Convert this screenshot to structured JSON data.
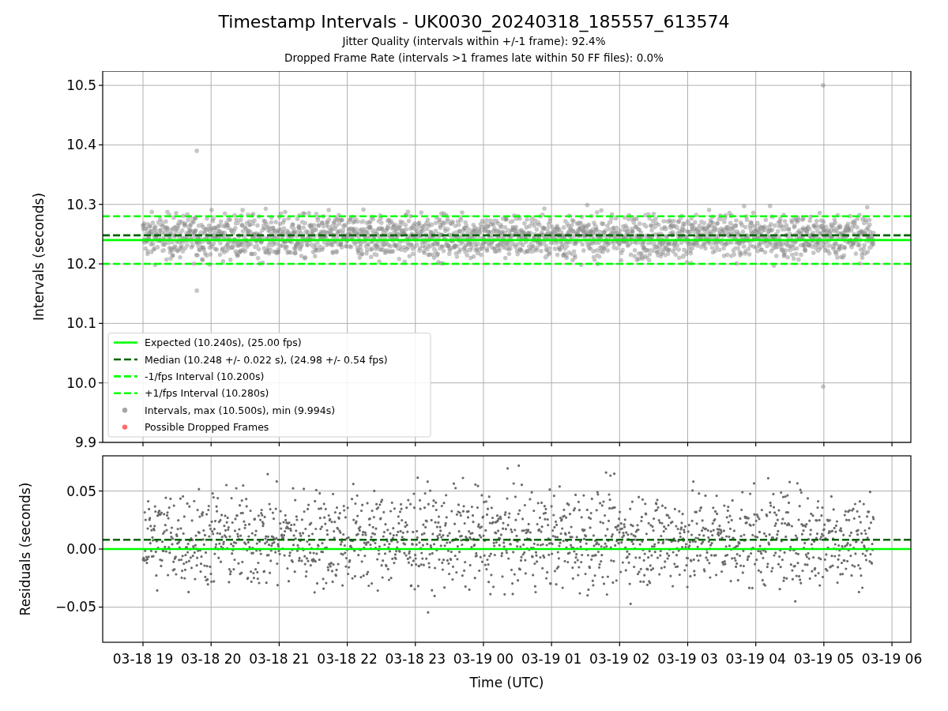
{
  "figure": {
    "title": "Timestamp Intervals - UK0030_20240318_185557_613574",
    "subtitles": [
      "Jitter Quality (intervals within +/-1 frame): 92.4%",
      "Dropped Frame Rate (intervals >1 frames late within 50 FF files): 0.0%"
    ]
  },
  "top_panel": {
    "chart_data": {
      "type": "scatter",
      "ylabel": "Intervals (seconds)",
      "grid": true,
      "legend": "lower left",
      "ylim": [
        9.9,
        10.524
      ],
      "yticks": [
        {
          "value": 9.9,
          "label": "9.9"
        },
        {
          "value": 10.0,
          "label": "10.0"
        },
        {
          "value": 10.1,
          "label": "10.1"
        },
        {
          "value": 10.2,
          "label": "10.2"
        },
        {
          "value": 10.3,
          "label": "10.3"
        },
        {
          "value": 10.4,
          "label": "10.4"
        },
        {
          "value": 10.5,
          "label": "10.5"
        }
      ],
      "ref_lines": [
        {
          "axis": "y",
          "value": 10.24,
          "label": "Expected (10.240s), (25.00 fps)",
          "color": "#00ff00"
        },
        {
          "axis": "y",
          "value": 10.248,
          "label": "Median (10.248 +/- 0.022 s), (24.98 +/- 0.54 fps)",
          "color": "#006400"
        },
        {
          "axis": "y",
          "value": 10.2,
          "label": "-1/fps Interval (10.200s)",
          "color": "#00ff00"
        },
        {
          "axis": "y",
          "value": 10.28,
          "label": "+1/fps Interval (10.280s)",
          "color": "#00ff00"
        }
      ],
      "series": [
        {
          "name": "Intervals, max (10.500s), min (9.994s)",
          "color": "#a6a6a6"
        },
        {
          "name": "Possible Dropped Frames",
          "color": "#ff6a6a"
        }
      ]
    }
  },
  "bottom_panel": {
    "chart_data": {
      "type": "scatter",
      "xlabel": "Time (UTC)",
      "ylabel": "Residuals (seconds)",
      "grid": true,
      "categories": [
        "03-18 19",
        "03-18 20",
        "03-18 21",
        "03-18 22",
        "03-18 23",
        "03-19 00",
        "03-19 01",
        "03-19 02",
        "03-19 03",
        "03-19 04",
        "03-19 05",
        "03-19 06"
      ],
      "ylim": [
        -0.0803,
        0.0803
      ],
      "yticks": [
        {
          "value": -0.05,
          "label": "−0.05"
        },
        {
          "value": 0,
          "label": "0.00"
        },
        {
          "value": 0.05,
          "label": "0.05"
        }
      ],
      "ref_lines": [
        {
          "axis": "y",
          "value": 0,
          "color": "#00ff00"
        },
        {
          "axis": "y",
          "value": 0.008,
          "color": "#006400"
        }
      ]
    }
  }
}
